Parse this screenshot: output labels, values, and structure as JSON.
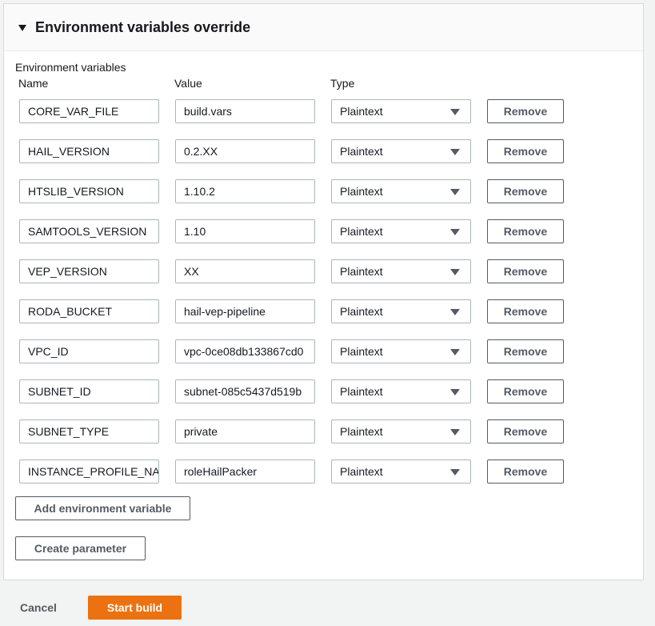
{
  "panel": {
    "title": "Environment variables override",
    "section_label": "Environment variables",
    "columns": {
      "name": "Name",
      "value": "Value",
      "type": "Type"
    },
    "rows": [
      {
        "name": "CORE_VAR_FILE",
        "value": "build.vars",
        "type": "Plaintext",
        "remove": "Remove"
      },
      {
        "name": "HAIL_VERSION",
        "value": "0.2.XX",
        "type": "Plaintext",
        "remove": "Remove"
      },
      {
        "name": "HTSLIB_VERSION",
        "value": "1.10.2",
        "type": "Plaintext",
        "remove": "Remove"
      },
      {
        "name": "SAMTOOLS_VERSION",
        "value": "1.10",
        "type": "Plaintext",
        "remove": "Remove"
      },
      {
        "name": "VEP_VERSION",
        "value": "XX",
        "type": "Plaintext",
        "remove": "Remove"
      },
      {
        "name": "RODA_BUCKET",
        "value": "hail-vep-pipeline",
        "type": "Plaintext",
        "remove": "Remove"
      },
      {
        "name": "VPC_ID",
        "value": "vpc-0ce08db133867cd0",
        "type": "Plaintext",
        "remove": "Remove"
      },
      {
        "name": "SUBNET_ID",
        "value": "subnet-085c5437d519b",
        "type": "Plaintext",
        "remove": "Remove"
      },
      {
        "name": "SUBNET_TYPE",
        "value": "private",
        "type": "Plaintext",
        "remove": "Remove"
      },
      {
        "name": "INSTANCE_PROFILE_NAI",
        "value": "roleHailPacker",
        "type": "Plaintext",
        "remove": "Remove"
      }
    ],
    "add_button": "Add environment variable",
    "create_parameter_button": "Create parameter"
  },
  "footer": {
    "cancel": "Cancel",
    "start_build": "Start build"
  },
  "colors": {
    "primary": "#ec7211",
    "background": "#f2f3f3",
    "border": "#aab7b8"
  }
}
